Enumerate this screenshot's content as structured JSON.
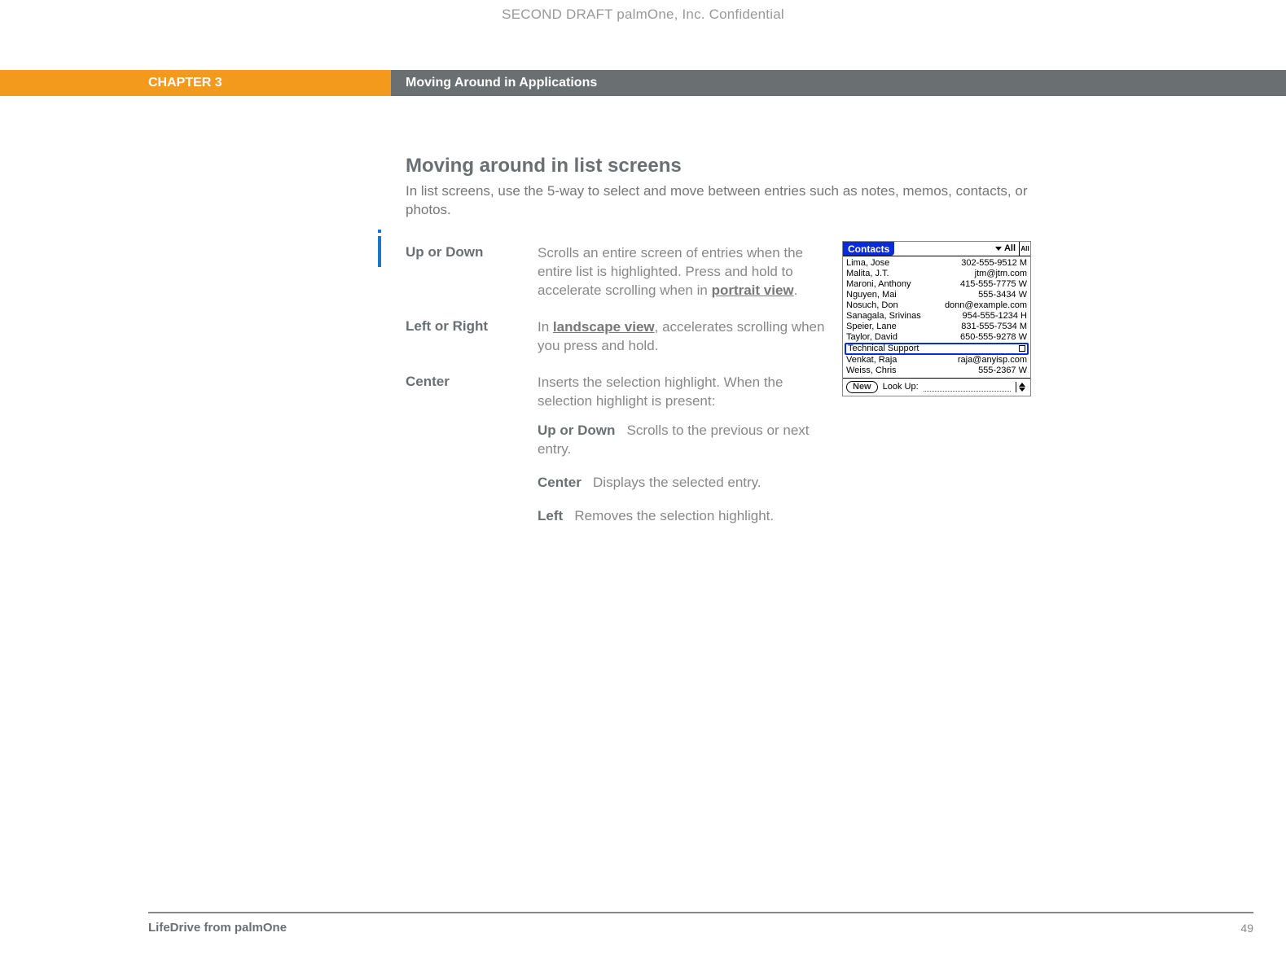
{
  "watermark": "SECOND DRAFT palmOne, Inc.  Confidential",
  "chapter": {
    "label": "CHAPTER 3",
    "title": "Moving Around in Applications"
  },
  "section": {
    "title": "Moving around in list screens",
    "intro": "In list screens, use the 5-way to select and move between entries such as notes, memos, contacts, or photos."
  },
  "defs": [
    {
      "term": "Up or Down",
      "desc_pre": "Scrolls an entire screen of entries when the entire list is highlighted. Press and hold to accelerate scrolling when in ",
      "desc_link": "portrait view",
      "desc_post": "."
    },
    {
      "term": "Left or Right",
      "desc_pre": "In ",
      "desc_link": "landscape view",
      "desc_post": ", accelerates scrolling when you press and hold."
    },
    {
      "term": "Center",
      "desc_pre": "Inserts the selection highlight. When the selection highlight is present:",
      "desc_link": "",
      "desc_post": ""
    }
  ],
  "subitems": [
    {
      "term": "Up or Down",
      "desc": "Scrolls to the previous or next entry."
    },
    {
      "term": "Center",
      "desc": "Displays the selected entry."
    },
    {
      "term": "Left",
      "desc": "Removes the selection highlight."
    }
  ],
  "device": {
    "title": "Contacts",
    "category": "All",
    "side": "All",
    "rows": [
      {
        "name": "Lima, Jose",
        "info": "302-555-9512 M",
        "sel": false,
        "flag": false
      },
      {
        "name": "Malita, J.T.",
        "info": "jtm@jtm.com",
        "sel": false,
        "flag": false
      },
      {
        "name": "Maroni, Anthony",
        "info": "415-555-7775 W",
        "sel": false,
        "flag": false
      },
      {
        "name": "Nguyen, Mai",
        "info": "555-3434 W",
        "sel": false,
        "flag": false
      },
      {
        "name": "Nosuch, Don",
        "info": "donn@example.com",
        "sel": false,
        "flag": false
      },
      {
        "name": "Sanagala, Srivinas",
        "info": "954-555-1234 H",
        "sel": false,
        "flag": false
      },
      {
        "name": "Speier, Lane",
        "info": "831-555-7534 M",
        "sel": false,
        "flag": false
      },
      {
        "name": "Taylor, David",
        "info": "650-555-9278 W",
        "sel": false,
        "flag": false
      },
      {
        "name": "Technical Support",
        "info": "",
        "sel": true,
        "flag": true
      },
      {
        "name": "Venkat, Raja",
        "info": "raja@anyisp.com",
        "sel": false,
        "flag": false
      },
      {
        "name": "Weiss, Chris",
        "info": "555-2367 W",
        "sel": false,
        "flag": false
      }
    ],
    "new_label": "New",
    "lookup_label": "Look Up:"
  },
  "footer": {
    "product": "LifeDrive from palmOne",
    "page": "49"
  }
}
